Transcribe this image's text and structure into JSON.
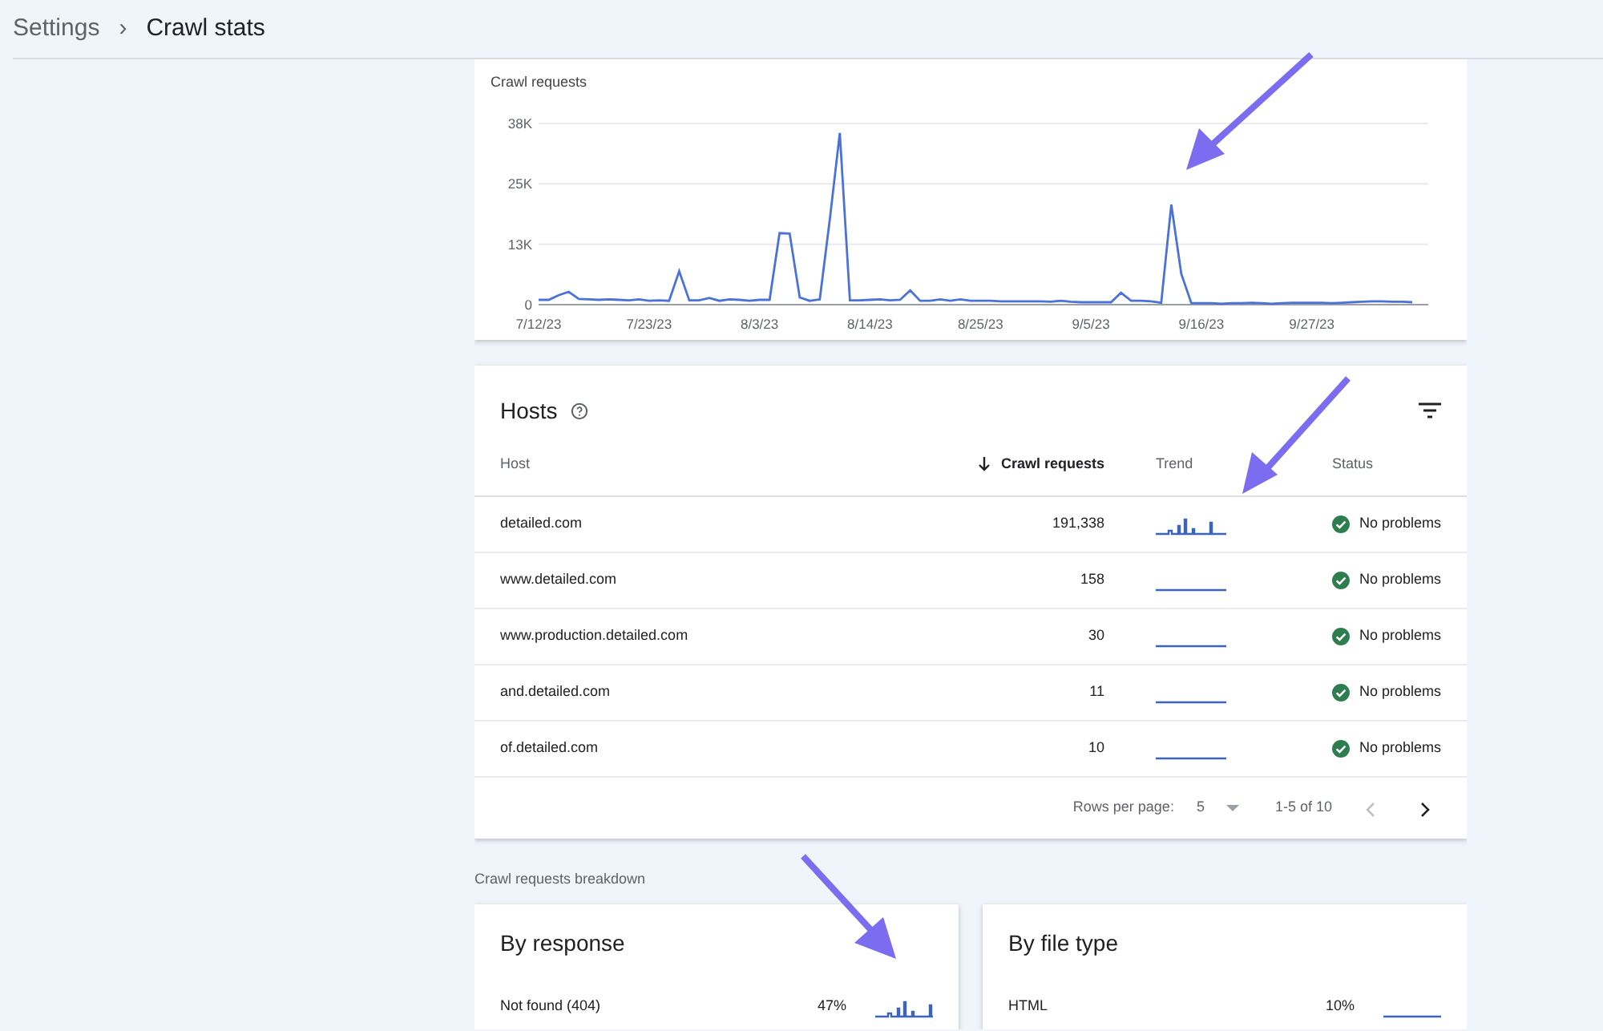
{
  "breadcrumb": [
    {
      "label": "Settings",
      "current": false
    },
    {
      "label": "Crawl stats",
      "current": true
    }
  ],
  "breadcrumb_separator": "›",
  "crawl_chart": {
    "chart_data": {
      "type": "line",
      "title": "Crawl requests",
      "categories": [
        "7/12/23",
        null,
        null,
        null,
        null,
        null,
        null,
        null,
        null,
        null,
        null,
        "7/23/23",
        null,
        null,
        null,
        null,
        null,
        null,
        null,
        null,
        null,
        null,
        "8/3/23",
        null,
        null,
        null,
        null,
        null,
        null,
        null,
        null,
        null,
        null,
        "8/14/23",
        null,
        null,
        null,
        null,
        null,
        null,
        null,
        null,
        null,
        null,
        "8/25/23",
        null,
        null,
        null,
        null,
        null,
        null,
        null,
        null,
        null,
        null,
        "9/5/23",
        null,
        null,
        null,
        null,
        null,
        null,
        null,
        null,
        null,
        null,
        "9/16/23",
        null,
        null,
        null,
        null,
        null,
        null,
        null,
        null,
        null,
        null,
        "9/27/23",
        null,
        null,
        null,
        null,
        null,
        null,
        null,
        null,
        null,
        null
      ],
      "series": [
        {
          "color": "#4a72d8",
          "values": [
            1000,
            1000,
            2000,
            2700,
            1200,
            1100,
            1000,
            1100,
            1000,
            900,
            1100,
            800,
            900,
            800,
            7000,
            900,
            900,
            1400,
            800,
            1100,
            1000,
            800,
            1000,
            1000,
            15000,
            14900,
            1500,
            800,
            1100,
            18000,
            36000,
            900,
            900,
            1000,
            1100,
            900,
            1000,
            3000,
            800,
            800,
            1100,
            800,
            1100,
            800,
            800,
            800,
            700,
            700,
            700,
            700,
            700,
            600,
            800,
            600,
            500,
            500,
            500,
            500,
            2500,
            800,
            800,
            700,
            400,
            21000,
            6500,
            300,
            300,
            300,
            200,
            300,
            300,
            400,
            300,
            200,
            300,
            400,
            400,
            400,
            400,
            300,
            400,
            500,
            600,
            700,
            700,
            600,
            600,
            500
          ]
        }
      ],
      "ylim": [
        0,
        38000
      ],
      "yticks": [
        {
          "value": 0,
          "label": "0"
        },
        {
          "value": 12667,
          "label": "13K"
        },
        {
          "value": 25333,
          "label": "25K"
        },
        {
          "value": 38000,
          "label": "38K"
        }
      ]
    }
  },
  "hosts": {
    "title": "Hosts",
    "columns": [
      {
        "label": "Host",
        "sorted": false
      },
      {
        "label": "Crawl requests",
        "sorted": true
      },
      {
        "label": "Trend",
        "sorted": false
      },
      {
        "label": "Status",
        "sorted": false
      }
    ],
    "rows": [
      {
        "host": "detailed.com",
        "requests": "191,338",
        "kind": "spiky",
        "status": "No problems"
      },
      {
        "host": "www.detailed.com",
        "requests": "158",
        "kind": "flat",
        "status": "No problems"
      },
      {
        "host": "www.production.detailed.com",
        "requests": "30",
        "kind": "flat",
        "status": "No problems"
      },
      {
        "host": "and.detailed.com",
        "requests": "11",
        "kind": "flat",
        "status": "No problems"
      },
      {
        "host": "of.detailed.com",
        "requests": "10",
        "kind": "flat",
        "status": "No problems"
      }
    ],
    "pagination": {
      "rows_label": "Rows per page:",
      "rows_value": "5",
      "range": "1-5 of 10",
      "prev_disabled": true,
      "next_disabled": false
    }
  },
  "breakdown": {
    "label": "Crawl requests breakdown",
    "cards": [
      {
        "title": "By response",
        "rows": [
          {
            "label": "Not found (404)",
            "share": "47%",
            "kind": "spiky"
          }
        ]
      },
      {
        "title": "By file type",
        "rows": [
          {
            "label": "HTML",
            "share": "10%",
            "kind": "flat"
          }
        ]
      }
    ]
  }
}
